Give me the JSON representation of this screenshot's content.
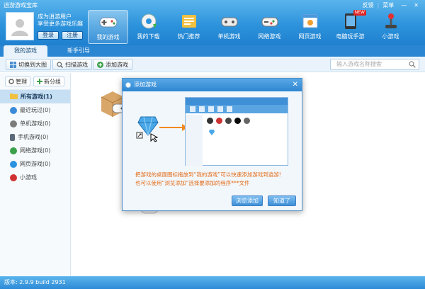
{
  "window": {
    "title": "逍游游戏宝库",
    "controls": [
      "反馈",
      "菜单",
      "—",
      "✕"
    ]
  },
  "user": {
    "line1": "成为逍游用户",
    "line2": "享受更多游戏乐趣",
    "login_label": "登录",
    "register_label": "注册"
  },
  "nav": [
    {
      "label": "我的游戏",
      "icon": "gamepad-icon",
      "active": true
    },
    {
      "label": "我的下载",
      "icon": "download-gear-icon"
    },
    {
      "label": "热门推荐",
      "icon": "hot-recommend-icon"
    },
    {
      "label": "单机游戏",
      "icon": "single-game-icon"
    },
    {
      "label": "网络游戏",
      "icon": "online-game-icon"
    },
    {
      "label": "网页游戏",
      "icon": "web-game-icon"
    },
    {
      "label": "电脑玩手游",
      "icon": "tablet-icon",
      "badge": "NEW"
    },
    {
      "label": "小游戏",
      "icon": "joystick-icon"
    }
  ],
  "subtabs": [
    "我的游戏",
    "新手引导"
  ],
  "toolbar": {
    "switch_view": "切换到大图",
    "scan_games": "扫描游戏",
    "add_game": "添加游戏",
    "search_placeholder": "输入游戏名称搜索"
  },
  "sidebar": {
    "manage": "管理",
    "new_group": "新分组",
    "items": [
      {
        "label": "所有游戏(1)",
        "active": true,
        "color": "#2b7fd0"
      },
      {
        "label": "最近玩过(0)",
        "color": "#3a8ad8"
      },
      {
        "label": "单机游戏(0)",
        "color": "#7c7c7c"
      },
      {
        "label": "手机游戏(0)",
        "color": "#5a6a7a"
      },
      {
        "label": "网络游戏(0)",
        "color": "#3aa04a"
      },
      {
        "label": "网页游戏(0)",
        "color": "#2b92e0"
      },
      {
        "label": "小游戏",
        "color": "#d03030"
      }
    ]
  },
  "dialog": {
    "title": "添加游戏",
    "message_line1": "把游戏的桌面图标拖放到“我的游戏”可以快速添加游戏到逍游!",
    "message_line2": "也可以使用“浏览添加”选择要添加的程序***文件",
    "browse_button": "浏览添加",
    "ok_button": "知道了"
  },
  "status": {
    "version": "版本: 2.9.9 build 2931"
  },
  "colors": {
    "header": "#2d93dc",
    "accent_orange": "#e36a14",
    "sidebar_active": "#c7dff3"
  }
}
